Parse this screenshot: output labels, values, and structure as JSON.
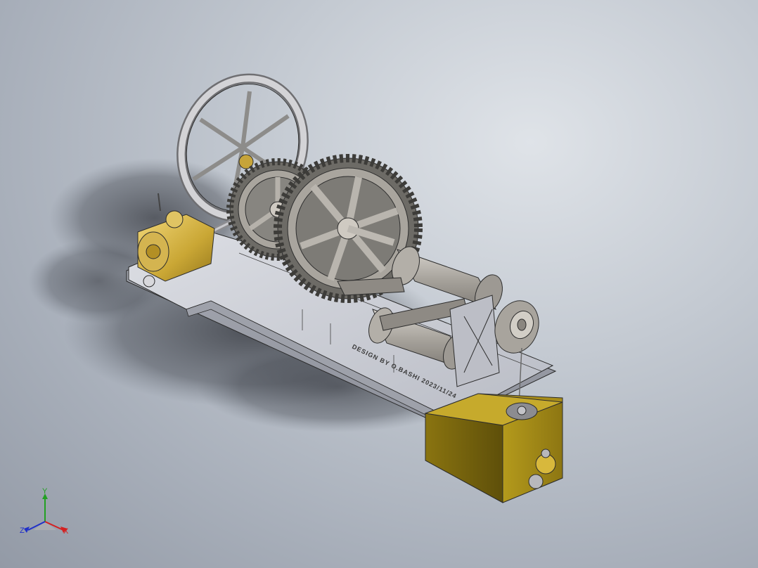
{
  "model": {
    "engraving": "DESIGN BY O.BASHI 2023/11/24"
  },
  "triad": {
    "x_label": "X",
    "y_label": "Y",
    "z_label": "Z",
    "x_color": "#d42020",
    "y_color": "#22a022",
    "z_color": "#2030c8"
  },
  "colors": {
    "brass": "#b89b2e",
    "steel": "#b8b4ae",
    "base": "#c8cbd2"
  }
}
